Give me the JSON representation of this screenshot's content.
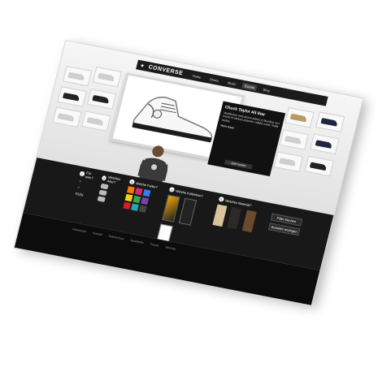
{
  "brand": {
    "name": "CONVERSE"
  },
  "nav": {
    "items": [
      "Home",
      "Shoes",
      "Music",
      "Events",
      "Blog"
    ],
    "active": 3
  },
  "feature": {
    "title": "Chuck Taylor All Star",
    "text": "Vestibulum ante ipsum primis in faucibus orci luctus et ultrices posuere cubilia curae; Nulla facilisi.",
    "link": "Mehr lesen",
    "button": "Jetzt kaufen"
  },
  "config": {
    "step1": {
      "label": "Für wen?",
      "options": [
        "♀",
        "♂",
        "Kids"
      ]
    },
    "step2": {
      "label": "Welches Alter?"
    },
    "step3": {
      "label": "Welche Farbe?",
      "colors": [
        "#ff7a00",
        "#d42a6a",
        "#2f7ff2",
        "#f3d21a",
        "#2fa84f",
        "#7d3fb0",
        "#d42020",
        "#26a6b0",
        "#444444"
      ]
    },
    "step4": {
      "label": "Welche Kollektion?"
    },
    "step5": {
      "label": "Welches Material?"
    },
    "buttons": {
      "reset": "Filter löschen",
      "apply": "Auswahl anzeigen"
    }
  },
  "footer": {
    "links": [
      "Impressum",
      "Kontakt",
      "Datenschutz",
      "Newsletter",
      "Presse",
      "Sitemap"
    ]
  }
}
